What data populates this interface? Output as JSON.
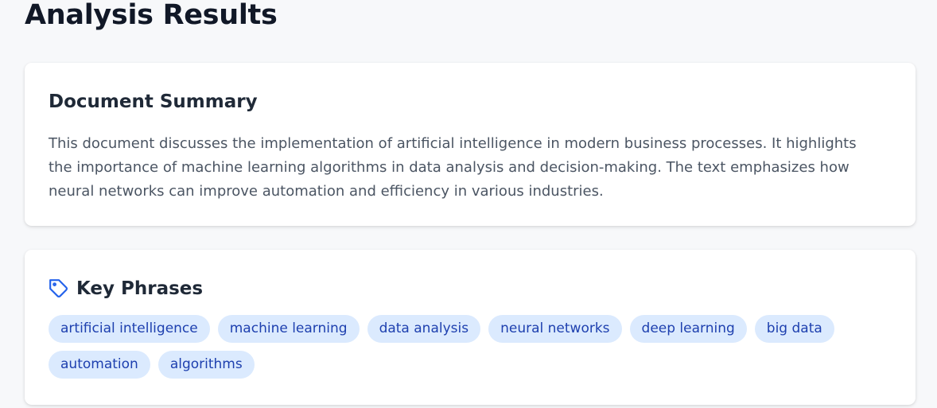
{
  "page": {
    "title": "Analysis Results"
  },
  "summary": {
    "heading": "Document Summary",
    "text": "This document discusses the implementation of artificial intelligence in modern business processes. It highlights the importance of machine learning algorithms in data analysis and decision-making. The text emphasizes how neural networks can improve automation and efficiency in various industries."
  },
  "key_phrases": {
    "heading": "Key Phrases",
    "icon": "tag-icon",
    "accent_color": "#2563eb",
    "tag_bg_color": "#dbeafe",
    "tag_text_color": "#1e40af",
    "items": [
      "artificial intelligence",
      "machine learning",
      "data analysis",
      "neural networks",
      "deep learning",
      "big data",
      "automation",
      "algorithms"
    ]
  }
}
